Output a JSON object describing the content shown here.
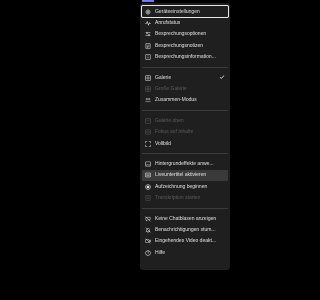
{
  "menu": {
    "g1": [
      {
        "label": "Geräteeinstellungen"
      },
      {
        "label": "Anrufstatus"
      },
      {
        "label": "Besprechungsoptionen"
      },
      {
        "label": "Besprechungsnotizen"
      },
      {
        "label": "Besprechungsinformation..."
      }
    ],
    "g2": [
      {
        "label": "Galerie"
      },
      {
        "label": "Große Galerie"
      },
      {
        "label": "Zusammen-Modus"
      }
    ],
    "g3": [
      {
        "label": "Galerie oben"
      },
      {
        "label": "Fokus auf Inhalte"
      },
      {
        "label": "Vollbild"
      }
    ],
    "g4": [
      {
        "label": "Hintergrundeffekte anwe..."
      },
      {
        "label": "Liveuntertitel aktivieren"
      },
      {
        "label": "Aufzeichnung beginnen"
      },
      {
        "label": "Transkription starten"
      }
    ],
    "g5": [
      {
        "label": "Keine Chatblasen anzeigen"
      },
      {
        "label": "Benachrichtigungen stum..."
      },
      {
        "label": "Eingehendes Video deakt..."
      },
      {
        "label": "Hilfe"
      }
    ]
  },
  "colors": {
    "menu_bg": "#1f1f1f",
    "highlight": "#3a3a3a",
    "accent": "#7b83eb"
  }
}
